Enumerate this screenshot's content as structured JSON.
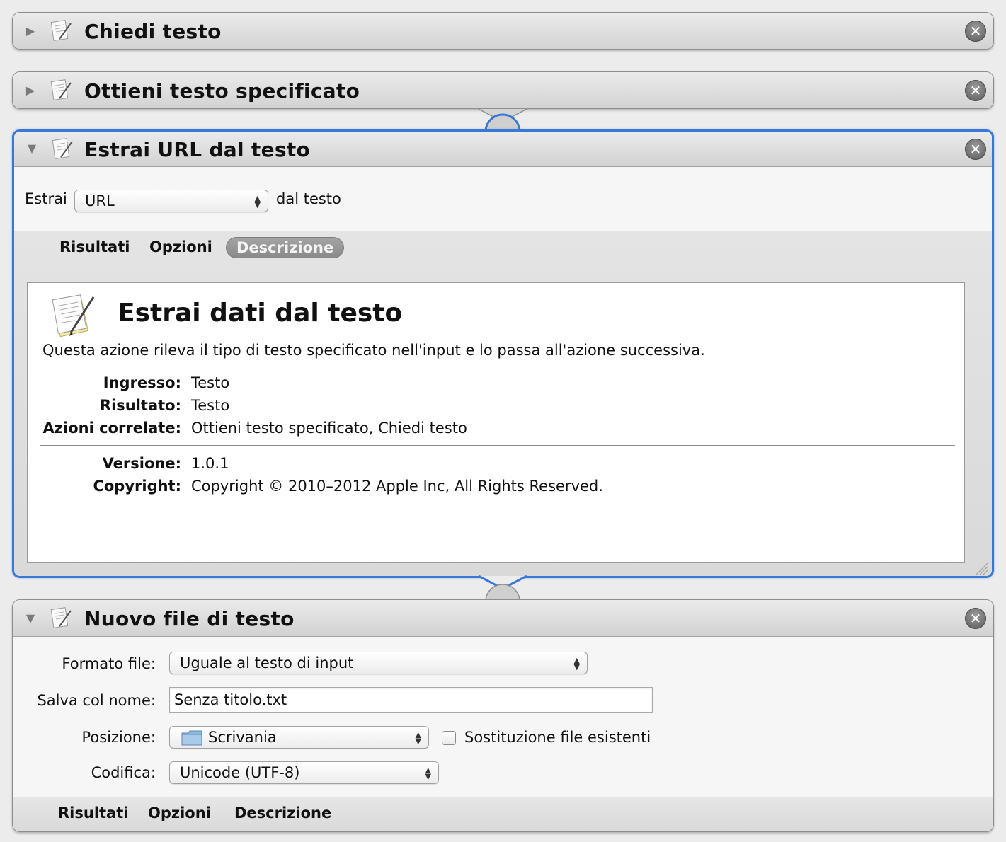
{
  "actions": [
    {
      "title": "Chiedi testo",
      "state": "collapsed"
    },
    {
      "title": "Ottieni testo specificato",
      "state": "collapsed"
    },
    {
      "title": "Estrai URL dal testo",
      "state": "expanded-selected",
      "extract_prefix": "Estrai",
      "extract_value": "URL",
      "extract_suffix": "dal testo",
      "tabs": [
        "Risultati",
        "Opzioni",
        "Descrizione"
      ],
      "active_tab": "Descrizione",
      "description": {
        "heading": "Estrai dati dal testo",
        "summary": "Questa azione rileva il tipo di testo specificato nell'input e lo passa all'azione successiva.",
        "fields": [
          {
            "key": "Ingresso:",
            "value": "Testo"
          },
          {
            "key": "Risultato:",
            "value": "Testo"
          },
          {
            "key": "Azioni correlate:",
            "value": "Ottieni testo specificato, Chiedi testo"
          }
        ],
        "meta": [
          {
            "key": "Versione:",
            "value": "1.0.1"
          },
          {
            "key": "Copyright:",
            "value": "Copyright © 2010–2012 Apple Inc, All Rights Reserved."
          }
        ]
      }
    },
    {
      "title": "Nuovo file di testo",
      "state": "expanded",
      "format_label": "Formato file:",
      "format_value": "Uguale al testo di input",
      "save_label": "Salva col nome:",
      "save_value": "Senza titolo.txt",
      "position_label": "Posizione:",
      "position_value": "Scrivania",
      "replace_label": "Sostituzione file esistenti",
      "replace_checked": false,
      "encoding_label": "Codifica:",
      "encoding_value": "Unicode (UTF-8)",
      "tabs": [
        "Risultati",
        "Opzioni",
        "Descrizione"
      ]
    }
  ],
  "icons": {
    "disclosure_collapsed": "▶",
    "disclosure_expanded": "▼",
    "close": "✕",
    "doc": "text-document-icon",
    "folder": "folder-icon"
  },
  "colors": {
    "selection": "#3a78d6",
    "header": "#d9d9d9"
  }
}
